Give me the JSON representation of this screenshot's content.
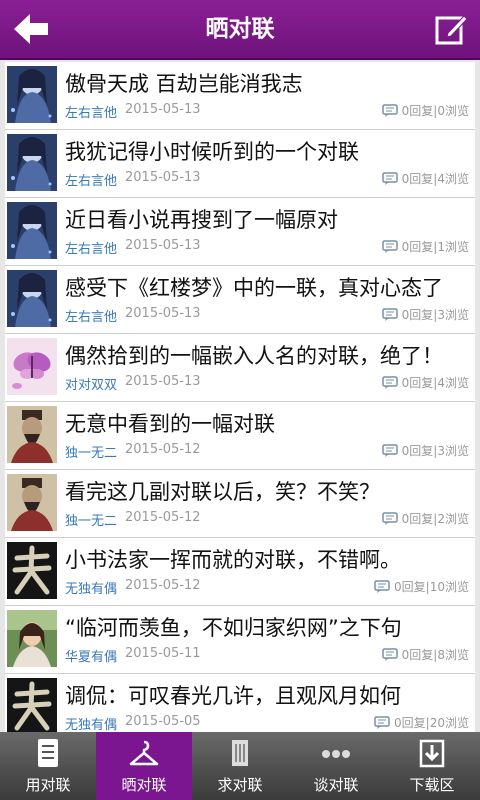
{
  "header": {
    "title": "晒对联",
    "back_icon": "back-arrow-icon",
    "edit_icon": "edit-icon"
  },
  "posts": [
    {
      "title": "傲骨天成 百劫岂能消我志",
      "author": "左右言他",
      "date": "2015-05-13",
      "stats": "0回复|0浏览",
      "avatar": "anime-girl"
    },
    {
      "title": "我犹记得小时候听到的一个对联",
      "author": "左右言他",
      "date": "2015-05-13",
      "stats": "0回复|4浏览",
      "avatar": "anime-girl"
    },
    {
      "title": "近日看小说再搜到了一幅原对",
      "author": "左右言他",
      "date": "2015-05-13",
      "stats": "0回复|1浏览",
      "avatar": "anime-girl"
    },
    {
      "title": "感受下《红楼梦》中的一联，真对心态了",
      "author": "左右言他",
      "date": "2015-05-13",
      "stats": "0回复|3浏览",
      "avatar": "anime-girl"
    },
    {
      "title": "偶然拾到的一幅嵌入人名的对联，绝了！",
      "author": "对对双双",
      "date": "2015-05-13",
      "stats": "0回复|4浏览",
      "avatar": "butterfly"
    },
    {
      "title": "无意中看到的一幅对联",
      "author": "独一无二",
      "date": "2015-05-12",
      "stats": "0回复|3浏览",
      "avatar": "ancient-portrait"
    },
    {
      "title": "看完这几副对联以后，笑？不笑？",
      "author": "独一无二",
      "date": "2015-05-12",
      "stats": "0回复|2浏览",
      "avatar": "ancient-portrait"
    },
    {
      "title": "小书法家一挥而就的对联，不错啊。",
      "author": "无独有偶",
      "date": "2015-05-12",
      "stats": "0回复|10浏览",
      "avatar": "calligraphy"
    },
    {
      "title": "“临河而羡鱼，不如归家织网”之下句",
      "author": "华夏有偶",
      "date": "2015-05-11",
      "stats": "0回复|8浏览",
      "avatar": "photo-girl"
    },
    {
      "title": "调侃：可叹春光几许，且观风月如何",
      "author": "无独有偶",
      "date": "2015-05-05",
      "stats": "0回复|20浏览",
      "avatar": "calligraphy"
    }
  ],
  "tabs": [
    {
      "label": "用对联",
      "icon": "document-icon"
    },
    {
      "label": "晒对联",
      "icon": "hanger-icon",
      "active": true
    },
    {
      "label": "求对联",
      "icon": "scroll-icon"
    },
    {
      "label": "谈对联",
      "icon": "more-dots-icon"
    },
    {
      "label": "下载区",
      "icon": "download-icon"
    }
  ],
  "colors": {
    "header": "#7a1888",
    "author": "#3a7ab8",
    "meta": "#9a9a9a",
    "tab_active": "#7b1690"
  }
}
